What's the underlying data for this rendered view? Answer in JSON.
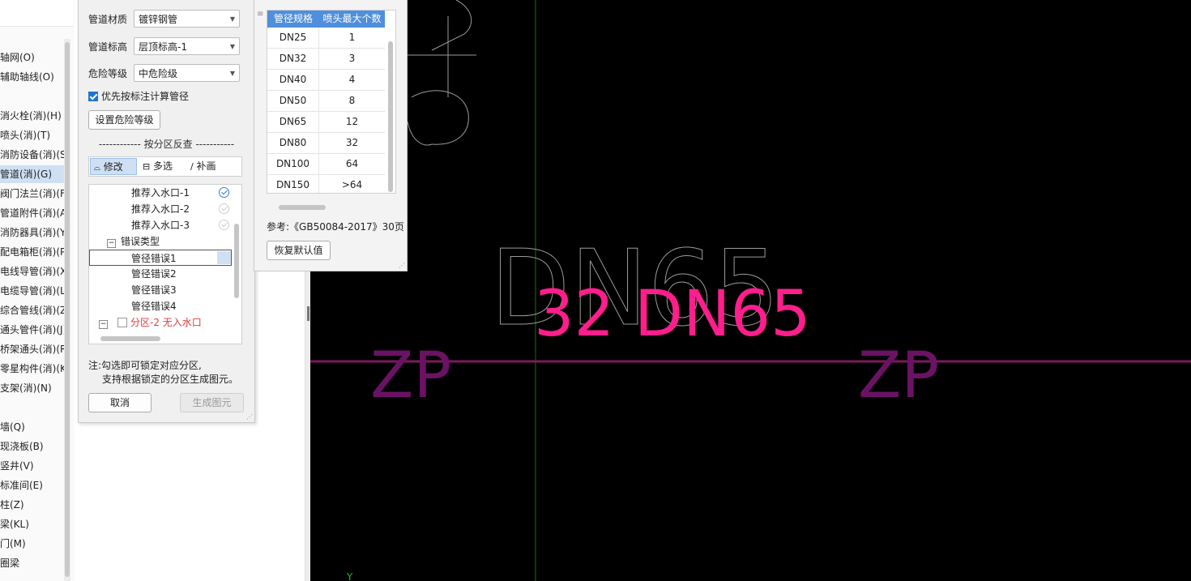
{
  "nav": {
    "items": [
      {
        "label": "轴网(O)",
        "selected": false
      },
      {
        "label": "辅助轴线(O)",
        "selected": false
      },
      {
        "label": "消火栓(消)(H)",
        "selected": false
      },
      {
        "label": "喷头(消)(T)",
        "selected": false
      },
      {
        "label": "消防设备(消)(S)",
        "selected": false
      },
      {
        "label": "管道(消)(G)",
        "selected": true
      },
      {
        "label": "阀门法兰(消)(F)",
        "selected": false
      },
      {
        "label": "管道附件(消)(A)",
        "selected": false
      },
      {
        "label": "消防器具(消)(Y)",
        "selected": false
      },
      {
        "label": "配电箱柜(消)(P)",
        "selected": false
      },
      {
        "label": "电线导管(消)(X)",
        "selected": false
      },
      {
        "label": "电缆导管(消)(L)",
        "selected": false
      },
      {
        "label": "综合管线(消)(Z)",
        "selected": false
      },
      {
        "label": "通头管件(消)(J)",
        "selected": false
      },
      {
        "label": "桥架通头(消)(R)",
        "selected": false
      },
      {
        "label": "零星构件(消)(K)",
        "selected": false
      },
      {
        "label": "支架(消)(N)",
        "selected": false
      },
      {
        "label": "墙(Q)",
        "selected": false
      },
      {
        "label": "现浇板(B)",
        "selected": false
      },
      {
        "label": "竖井(V)",
        "selected": false
      },
      {
        "label": "标准间(E)",
        "selected": false
      },
      {
        "label": "柱(Z)",
        "selected": false
      },
      {
        "label": "梁(KL)",
        "selected": false
      },
      {
        "label": "门(M)",
        "selected": false
      },
      {
        "label": "圈梁",
        "selected": false
      }
    ]
  },
  "dialog": {
    "pipe_material": {
      "label": "管道材质",
      "value": "镀锌钢管"
    },
    "pipe_elevation": {
      "label": "管道标高",
      "value": "层顶标高-1"
    },
    "hazard_level": {
      "label": "危险等级",
      "value": "中危险级"
    },
    "prefer_annotation": {
      "label": "优先按标注计算管径",
      "checked": true
    },
    "set_hazard_button": "设置危险等级",
    "section_label": "------------  按分区反查  -----------",
    "toolbar": {
      "modify": "修改",
      "multi_select": "多选",
      "redraw": "补画"
    },
    "tree": [
      {
        "label": "推荐入水口-1",
        "indent": 2,
        "status": "checked"
      },
      {
        "label": "推荐入水口-2",
        "indent": 2,
        "status": "dim"
      },
      {
        "label": "推荐入水口-3",
        "indent": 2,
        "status": "dim"
      },
      {
        "label": "错误类型",
        "indent": 1,
        "expander": "−"
      },
      {
        "label": "管径错误1",
        "indent": 2,
        "selected": true
      },
      {
        "label": "管径错误2",
        "indent": 2
      },
      {
        "label": "管径错误3",
        "indent": 2
      },
      {
        "label": "管径错误4",
        "indent": 2
      },
      {
        "label": "分区-2 无入水口",
        "indent": 0,
        "expander": "−",
        "checkbox": true,
        "error": true
      }
    ],
    "note_line1": "注:勾选即可锁定对应分区,",
    "note_line2": "支持根据锁定的分区生成图元。",
    "cancel_button": "取消",
    "generate_button": "生成图元"
  },
  "spec_table": {
    "headers": [
      "管径规格",
      "喷头最大个数"
    ],
    "rows": [
      [
        "DN25",
        "1"
      ],
      [
        "DN32",
        "3"
      ],
      [
        "DN40",
        "4"
      ],
      [
        "DN50",
        "8"
      ],
      [
        "DN65",
        "12"
      ],
      [
        "DN80",
        "32"
      ],
      [
        "DN100",
        "64"
      ],
      [
        "DN150",
        ">64"
      ]
    ],
    "reference": "参考:《GB50084-2017》30页",
    "restore_button": "恢复默认值"
  },
  "canvas": {
    "main_label": "32 DN65",
    "ghost_label": "DN65",
    "zp_left": "ZP",
    "zp_right": "ZP",
    "axis_label": "Y",
    "colors": {
      "pipe": "#7a1a5e",
      "label": "#ff1e8c",
      "axis": "#1db81d"
    }
  }
}
